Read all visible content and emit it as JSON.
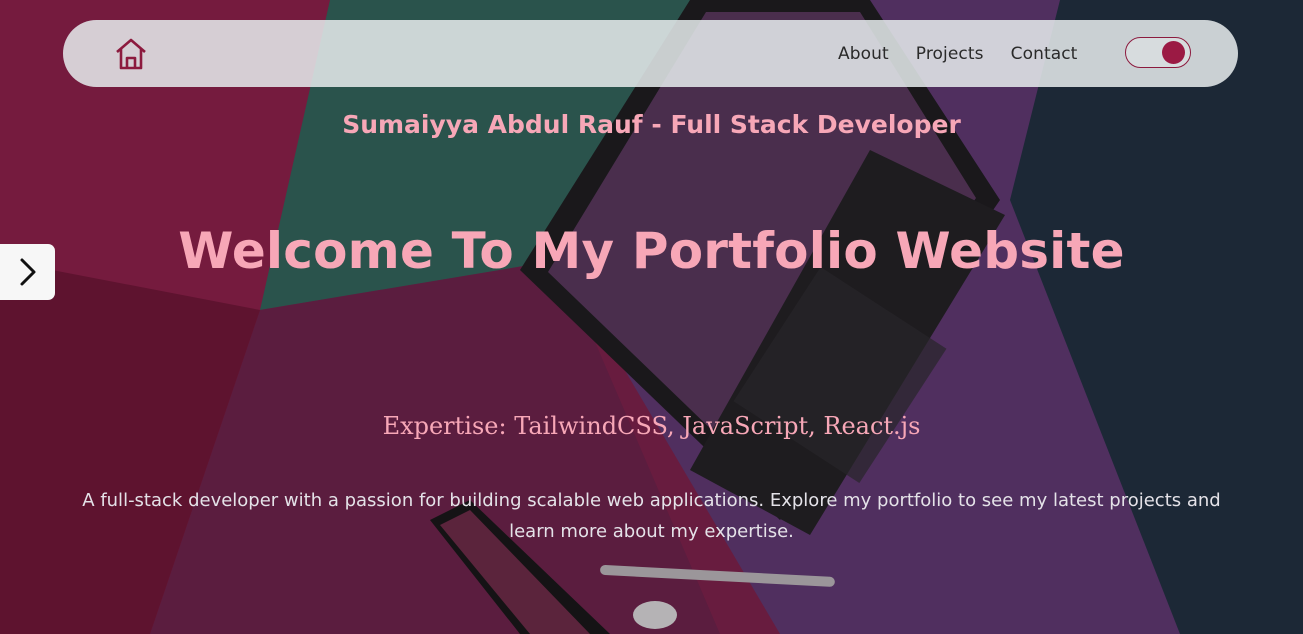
{
  "colors": {
    "accent": "#9b1a44",
    "heading_pink": "#f7a7b7",
    "navbar_bg": "#e6ecee"
  },
  "navbar": {
    "home_icon": "home-icon",
    "links": [
      {
        "label": "About"
      },
      {
        "label": "Projects"
      },
      {
        "label": "Contact"
      }
    ],
    "theme_toggle": {
      "state": "on"
    }
  },
  "side_nav": {
    "icon": "chevron-right-icon"
  },
  "hero": {
    "subtitle": "Sumaiyya Abdul Rauf - Full Stack Developer",
    "title": "Welcome To My Portfolio Website",
    "expertise": "Expertise: TailwindCSS, JavaScript, React.js",
    "description": "A full-stack developer with a passion for building scalable web applications. Explore my portfolio to see my latest projects and learn more about my expertise."
  }
}
